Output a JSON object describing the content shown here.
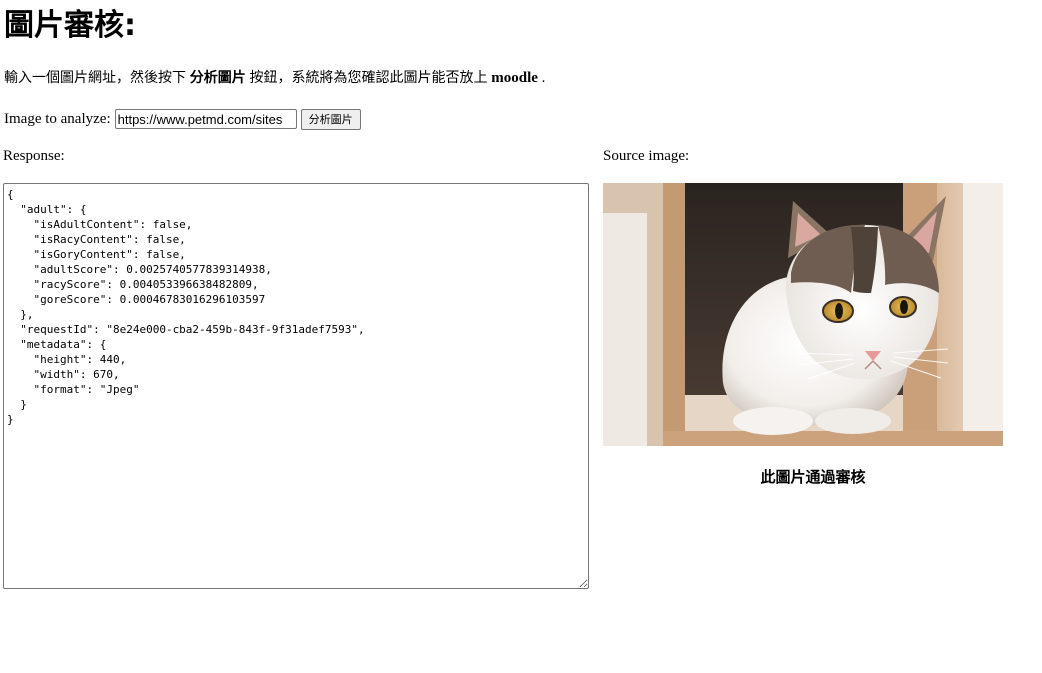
{
  "page": {
    "title": "圖片審核:",
    "intro": {
      "prefix": "輸入一個圖片網址，然後按下",
      "button_ref": "分析圖片",
      "middle": "按鈕，系統將為您確認此圖片能否放上",
      "target": "moodle",
      "suffix": "."
    },
    "analyze": {
      "label": "Image to analyze:",
      "url_value": "https://www.petmd.com/sites",
      "button_label": "分析圖片"
    },
    "response_label": "Response:",
    "source_label": "Source image:",
    "response_json": "{\n  \"adult\": {\n    \"isAdultContent\": false,\n    \"isRacyContent\": false,\n    \"isGoryContent\": false,\n    \"adultScore\": 0.0025740577839314938,\n    \"racyScore\": 0.004053396638482809,\n    \"goreScore\": 0.00046783016296103597\n  },\n  \"requestId\": \"8e24e000-cba2-459b-843f-9f31adef7593\",\n  \"metadata\": {\n    \"height\": 440,\n    \"width\": 670,\n    \"format\": \"Jpeg\"\n  }\n}",
    "result_text": "此圖片通過審核"
  }
}
